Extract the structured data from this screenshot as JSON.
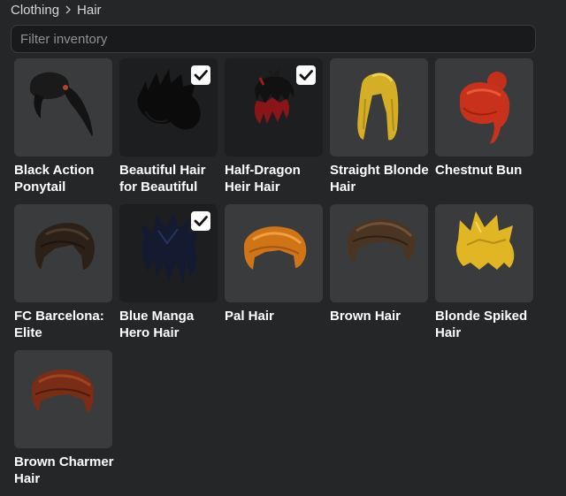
{
  "breadcrumb": {
    "parent": "Clothing",
    "current": "Hair"
  },
  "filter": {
    "placeholder": "Filter inventory",
    "value": ""
  },
  "items": [
    {
      "name": "Black Action Ponytail",
      "equipped": false,
      "color": "#1a1a1a",
      "icon": "ponytail-hair-icon"
    },
    {
      "name": "Beautiful Hair for Beautiful",
      "equipped": true,
      "color": "#0d0d0d",
      "icon": "spiky-black-hair-icon"
    },
    {
      "name": "Half-Dragon Heir Hair",
      "equipped": true,
      "color": "#8b1418",
      "icon": "red-black-hair-icon"
    },
    {
      "name": "Straight Blonde Hair",
      "equipped": false,
      "color": "#d8b52a",
      "icon": "long-blonde-hair-icon"
    },
    {
      "name": "Chestnut Bun",
      "equipped": false,
      "color": "#c8321c",
      "icon": "red-bun-hair-icon"
    },
    {
      "name": "FC Barcelona: Elite",
      "equipped": false,
      "color": "#2b2119",
      "icon": "dark-brown-hair-icon"
    },
    {
      "name": "Blue Manga Hero Hair",
      "equipped": true,
      "color": "#1a2340",
      "icon": "blue-manga-hair-icon"
    },
    {
      "name": "Pal Hair",
      "equipped": false,
      "color": "#cf7417",
      "icon": "orange-hair-icon"
    },
    {
      "name": "Brown Hair",
      "equipped": false,
      "color": "#4a3523",
      "icon": "brown-hair-icon"
    },
    {
      "name": "Blonde Spiked Hair",
      "equipped": false,
      "color": "#e0b624",
      "icon": "blonde-spiked-hair-icon"
    },
    {
      "name": "Brown Charmer Hair",
      "equipped": false,
      "color": "#7a2d16",
      "icon": "auburn-hair-icon"
    }
  ]
}
